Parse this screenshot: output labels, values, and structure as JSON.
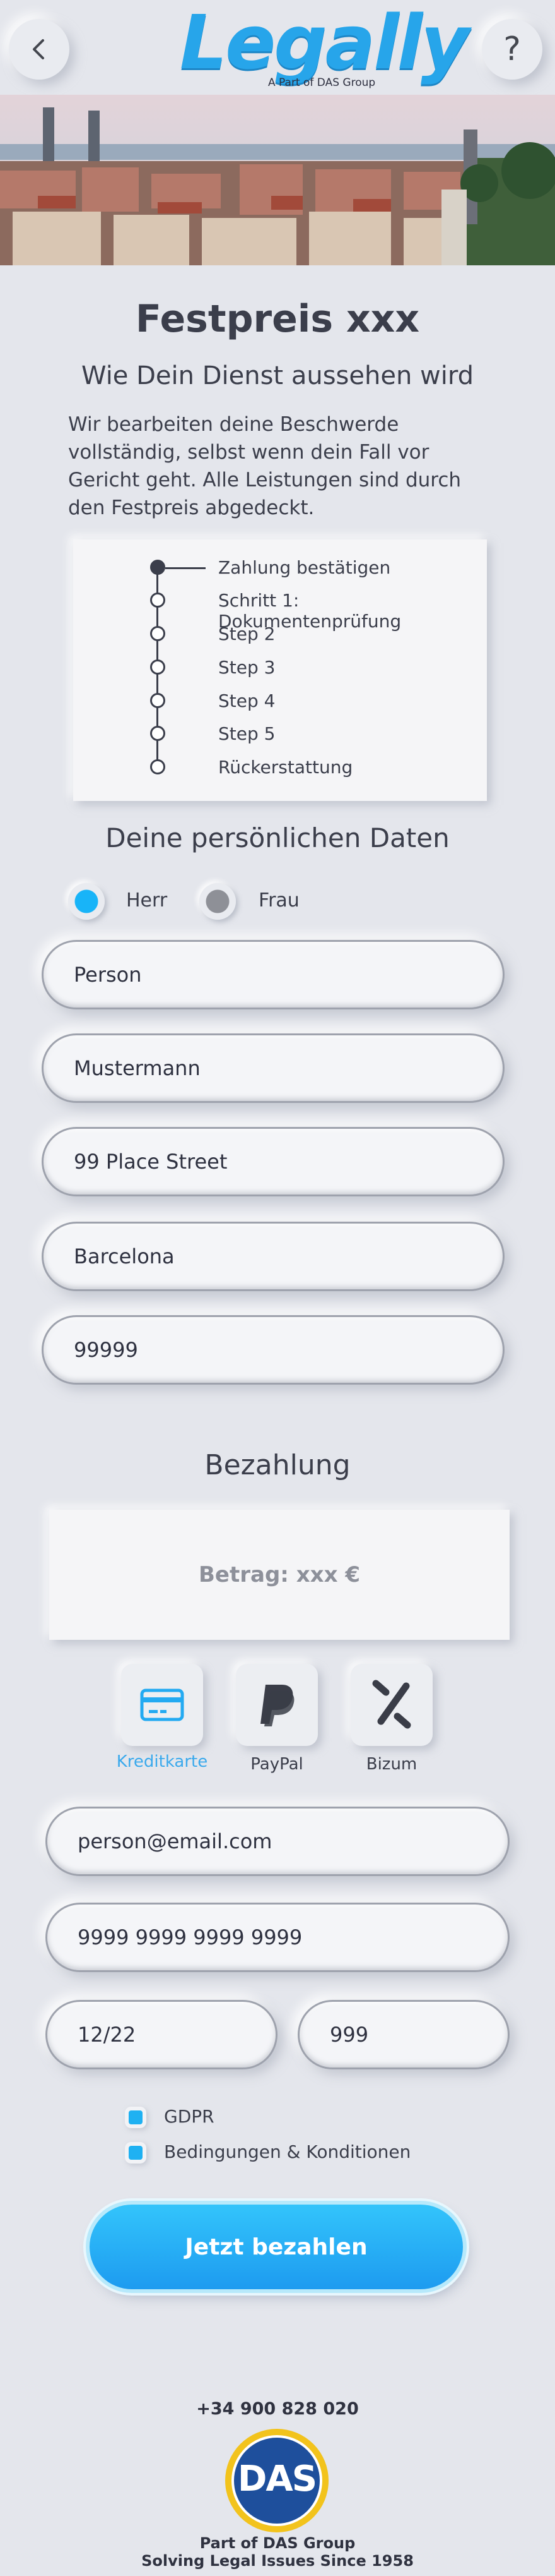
{
  "header": {
    "back_icon": "chevron-left-icon",
    "help_label": "?",
    "logo_text": "Legally",
    "logo_tagline": "A Part of DAS Group"
  },
  "hero_image": "barcelona-cityscape",
  "main": {
    "title": "Festpreis xxx",
    "subtitle": "Wie Dein Dienst aussehen wird",
    "description": "Wir bearbeiten deine Beschwerde vollständig, selbst wenn dein Fall vor Gericht geht. Alle Leistungen sind durch den Festpreis abgedeckt.",
    "steps": [
      "Zahlung bestätigen",
      "Schritt 1: Dokumentenprüfung",
      "Step 2",
      "Step 3",
      "Step 4",
      "Step 5",
      "Rückerstattung"
    ]
  },
  "personal": {
    "heading": "Deine persönlichen Daten",
    "salutation_options": [
      "Herr",
      "Frau"
    ],
    "selected_salutation": "Herr",
    "first_name": "Person",
    "last_name": "Mustermann",
    "street": "99 Place Street",
    "city": "Barcelona",
    "postcode": "99999"
  },
  "payment": {
    "heading": "Bezahlung",
    "amount_label": "Betrag: xxx €",
    "methods": [
      {
        "label": "Kreditkarte",
        "icon": "credit-card-icon",
        "selected": true
      },
      {
        "label": "PayPal",
        "icon": "paypal-icon",
        "selected": false
      },
      {
        "label": "Bizum",
        "icon": "bizum-icon",
        "selected": false
      }
    ],
    "email": "person@email.com",
    "card_number": "9999 9999 9999 9999",
    "expiry": "12/22",
    "cvc": "999",
    "checkboxes": [
      "GDPR",
      "Bedingungen & Konditionen"
    ],
    "submit_label": "Jetzt bezahlen"
  },
  "footer": {
    "phone": "+34 900 828 020",
    "logo_text": "DAS",
    "line1": "Part of DAS Group",
    "line2": "Solving Legal Issues Since 1958"
  },
  "colors": {
    "accent": "#1fa9f2",
    "background": "#e4e6ec",
    "text": "#3b3e4b"
  }
}
